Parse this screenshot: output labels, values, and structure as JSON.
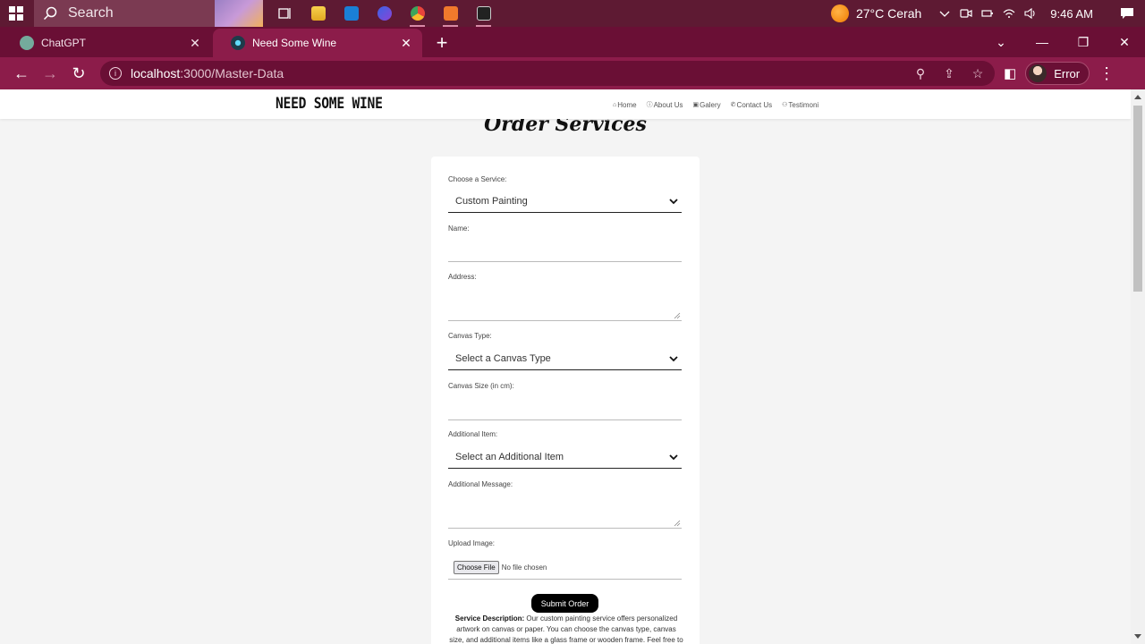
{
  "taskbar": {
    "search_label": "Search",
    "weather": "27°C  Cerah",
    "time": "9:46 AM",
    "apps": [
      "file-explorer-icon",
      "mail-icon",
      "media-icon",
      "chrome-icon",
      "sublime-icon",
      "terminal-icon"
    ]
  },
  "browser": {
    "tabs": [
      {
        "title": "ChatGPT",
        "active": false
      },
      {
        "title": "Need Some Wine",
        "active": true
      }
    ],
    "url_host": "localhost",
    "url_path": ":3000/Master-Data",
    "profile_label": "Error"
  },
  "site": {
    "brand": "NEED SOME WINE",
    "nav": [
      {
        "icon": "⌂",
        "label": "Home"
      },
      {
        "icon": "ⓘ",
        "label": "About Us"
      },
      {
        "icon": "▣",
        "label": "Galery"
      },
      {
        "icon": "✆",
        "label": "Contact Us"
      },
      {
        "icon": "⚇",
        "label": "Testimoni"
      }
    ]
  },
  "form": {
    "title": "Order Services",
    "service_label": "Choose a Service:",
    "service_value": "Custom Painting",
    "name_label": "Name:",
    "address_label": "Address:",
    "canvas_type_label": "Canvas Type:",
    "canvas_type_value": "Select a Canvas Type",
    "canvas_size_label": "Canvas Size (in cm):",
    "additional_item_label": "Additional Item:",
    "additional_item_value": "Select an Additional Item",
    "message_label": "Additional Message:",
    "upload_label": "Upload Image:",
    "choose_file": "Choose File",
    "no_file": "No file chosen",
    "submit": "Submit Order",
    "desc_heading": "Service Description:",
    "desc_text": " Our custom painting service offers personalized artwork on canvas or paper. You can choose the canvas type, canvas size, and additional items like a glass frame or wooden frame. Feel free to add"
  },
  "colors": {
    "taskbar": "#5e1a33",
    "tabstrip": "#6a0f35",
    "toolbar": "#8c1c4a"
  }
}
